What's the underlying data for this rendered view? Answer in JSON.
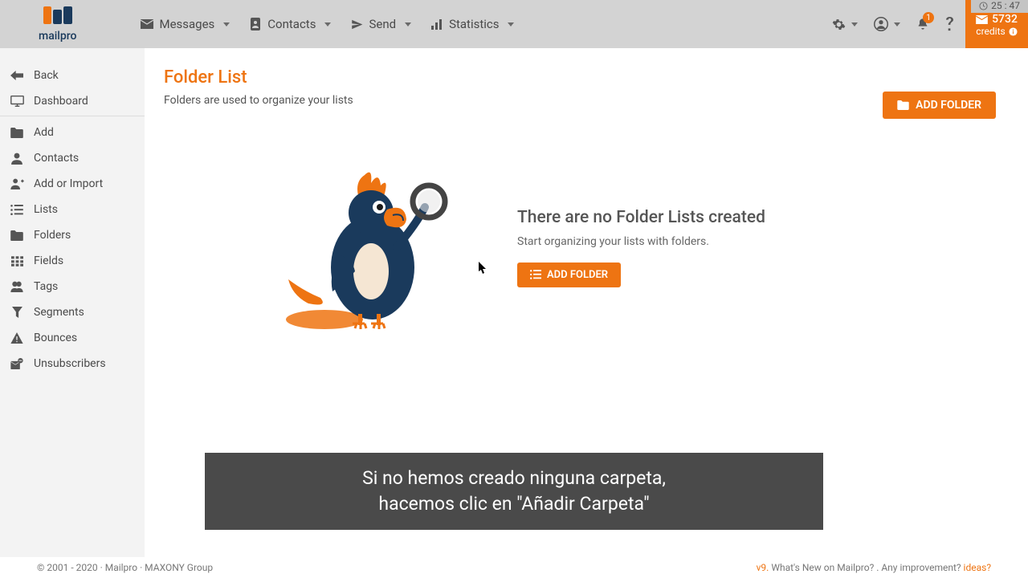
{
  "brand": {
    "name": "mailpro"
  },
  "timer": {
    "value": "25 : 47"
  },
  "nav": {
    "messages": "Messages",
    "contacts": "Contacts",
    "send": "Send",
    "statistics": "Statistics"
  },
  "credits": {
    "count": "5732",
    "label": "credits"
  },
  "notifications": {
    "count": "1"
  },
  "sidebar": {
    "back": "Back",
    "dashboard": "Dashboard",
    "add": "Add",
    "contacts": "Contacts",
    "addImport": "Add or Import",
    "lists": "Lists",
    "folders": "Folders",
    "fields": "Fields",
    "tags": "Tags",
    "segments": "Segments",
    "bounces": "Bounces",
    "unsubscribers": "Unsubscribers"
  },
  "page": {
    "title": "Folder List",
    "subtitle": "Folders are used to organize your lists",
    "addFolderBtn": "ADD FOLDER"
  },
  "empty": {
    "heading": "There are no Folder Lists created",
    "sub": "Start organizing your lists with folders.",
    "btn": "ADD FOLDER"
  },
  "caption": {
    "line1": "Si no hemos creado ninguna carpeta,",
    "line2": "hacemos clic en \"Añadir Carpeta\""
  },
  "footer": {
    "left": "© 2001 - 2020 · Mailpro · MAXONY Group",
    "version": "v9.",
    "whatsnew": " What's New on Mailpro? . Any improvement? ",
    "ideas": "ideas?"
  }
}
